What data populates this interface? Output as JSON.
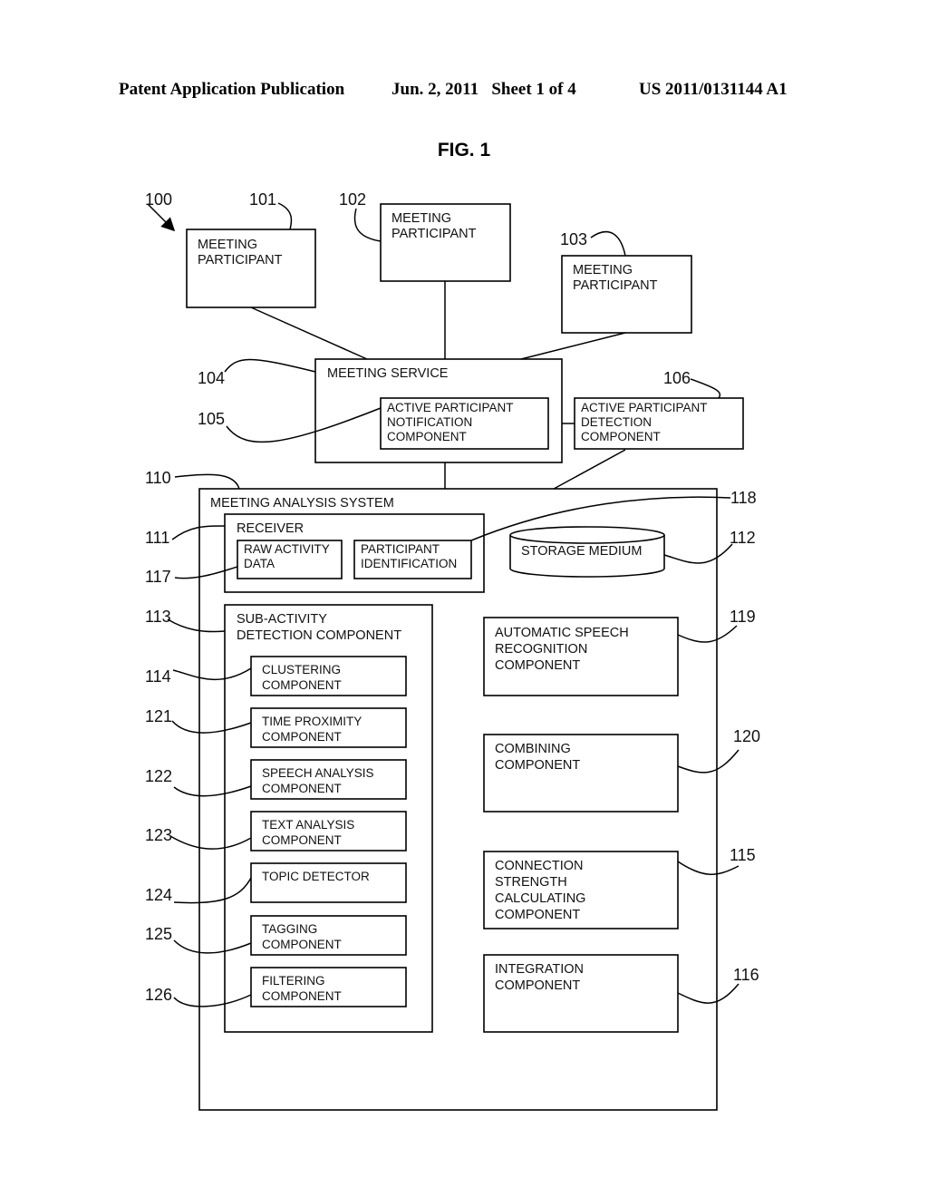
{
  "header": {
    "publication": "Patent Application Publication",
    "date_sheet": "Jun. 2, 2011   Sheet 1 of 4",
    "patent_number": "US 2011/0131144 A1"
  },
  "figure": {
    "title": "FIG. 1"
  },
  "refs": {
    "system": "100",
    "p1": "101",
    "p2": "102",
    "p3": "103",
    "meeting_service": "104",
    "notification": "105",
    "detection": "106",
    "analysis_system": "110",
    "receiver": "111",
    "storage": "112",
    "sub_activity": "113",
    "clustering": "114",
    "connection_strength": "115",
    "integration": "116",
    "raw_activity": "117",
    "participant_id": "118",
    "asr": "119",
    "combining": "120",
    "time_proximity": "121",
    "speech_analysis": "122",
    "text_analysis": "123",
    "topic": "124",
    "tagging": "125",
    "filtering": "126"
  },
  "boxes": {
    "p1": [
      "MEETING",
      "PARTICIPANT"
    ],
    "p2": [
      "MEETING",
      "PARTICIPANT"
    ],
    "p3": [
      "MEETING",
      "PARTICIPANT"
    ],
    "meeting_service": [
      "MEETING SERVICE"
    ],
    "notification": [
      "ACTIVE PARTICIPANT",
      "NOTIFICATION",
      "COMPONENT"
    ],
    "detection": [
      "ACTIVE PARTICIPANT",
      "DETECTION",
      "COMPONENT"
    ],
    "analysis_system": [
      "MEETING ANALYSIS SYSTEM"
    ],
    "receiver": [
      "RECEIVER"
    ],
    "raw_activity": [
      "RAW ACTIVITY",
      "DATA"
    ],
    "participant_id": [
      "PARTICIPANT",
      "IDENTIFICATION"
    ],
    "storage": [
      "STORAGE MEDIUM"
    ],
    "sub_activity": [
      "SUB-ACTIVITY",
      "DETECTION COMPONENT"
    ],
    "clustering": [
      "CLUSTERING",
      "COMPONENT"
    ],
    "time_proximity": [
      "TIME PROXIMITY",
      "COMPONENT"
    ],
    "speech_analysis": [
      "SPEECH ANALYSIS",
      "COMPONENT"
    ],
    "text_analysis": [
      "TEXT ANALYSIS",
      "COMPONENT"
    ],
    "topic": [
      "TOPIC DETECTOR"
    ],
    "tagging": [
      "TAGGING",
      "COMPONENT"
    ],
    "filtering": [
      "FILTERING",
      "COMPONENT"
    ],
    "asr": [
      "AUTOMATIC SPEECH",
      "RECOGNITION",
      "COMPONENT"
    ],
    "combining": [
      "COMBINING",
      "COMPONENT"
    ],
    "connection_strength": [
      "CONNECTION",
      "STRENGTH",
      "CALCULATING",
      "COMPONENT"
    ],
    "integration": [
      "INTEGRATION",
      "COMPONENT"
    ]
  }
}
